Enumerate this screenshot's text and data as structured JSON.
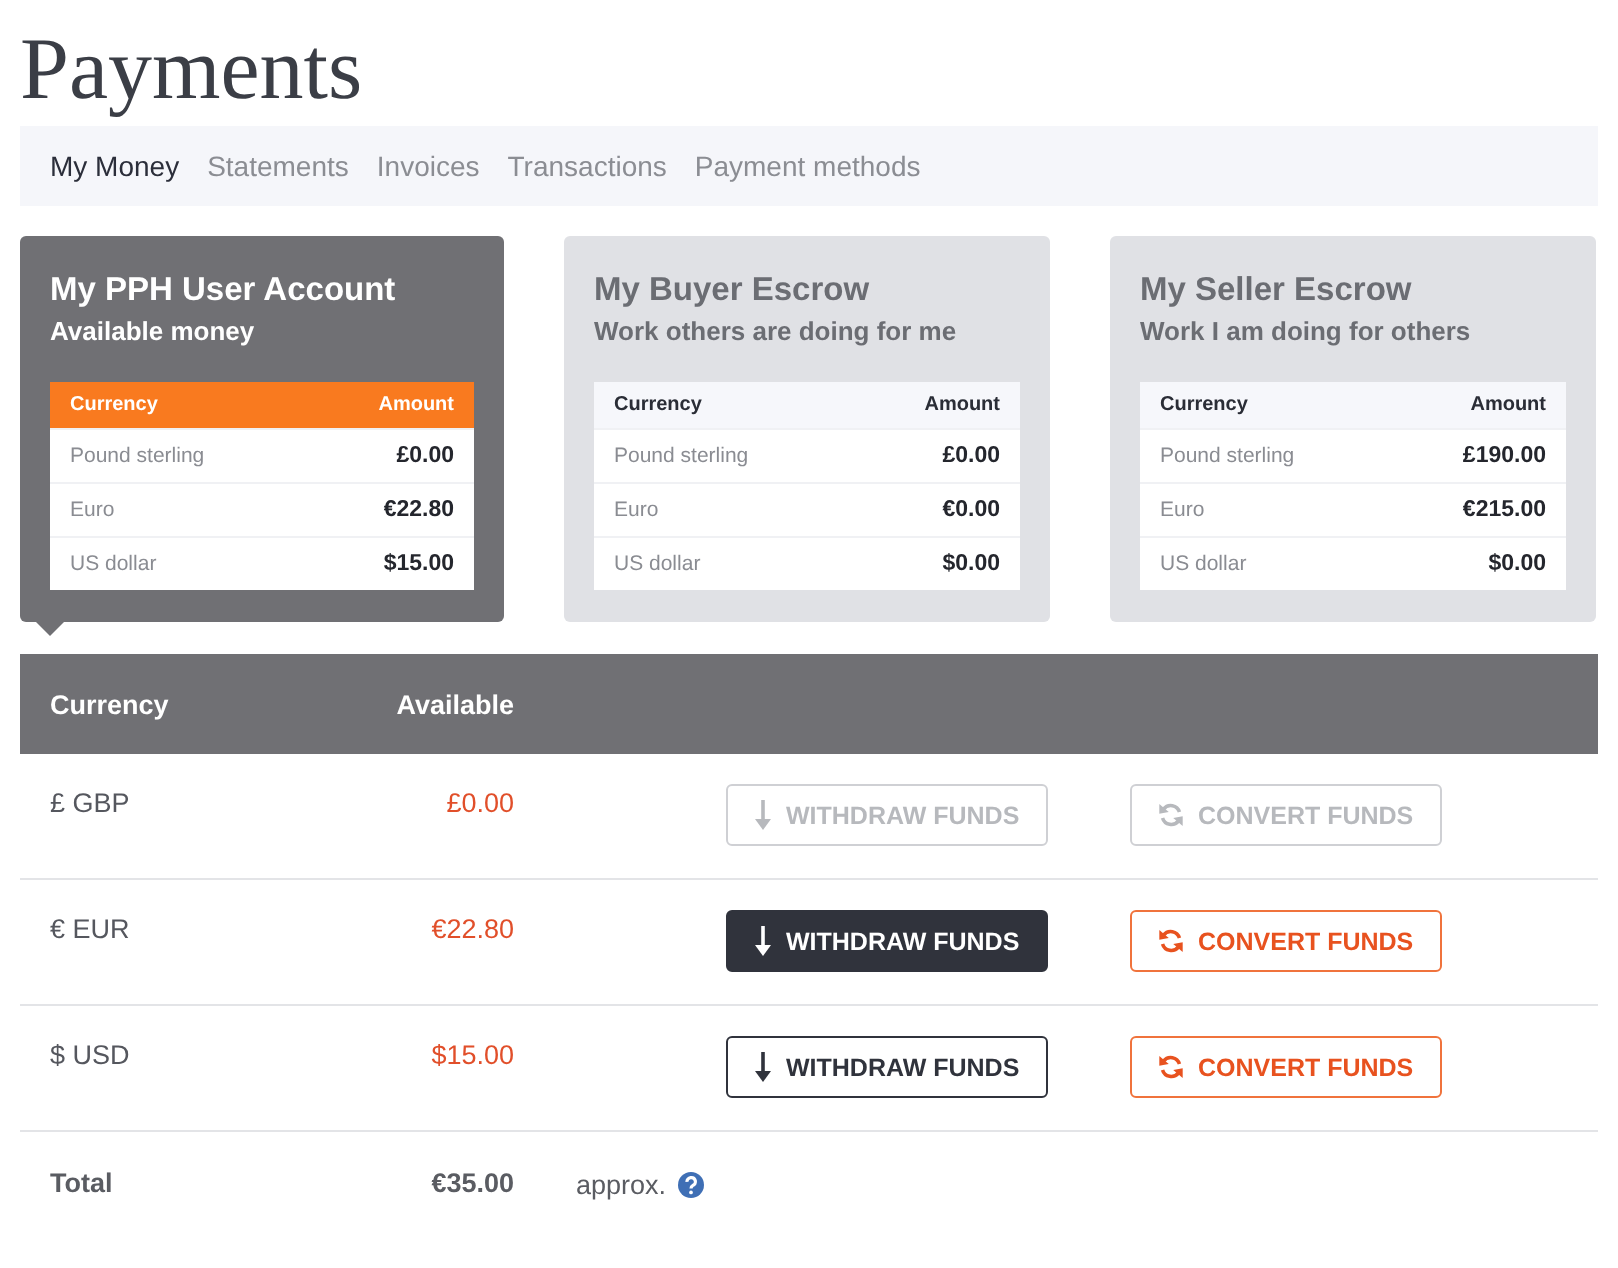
{
  "page": {
    "title": "Payments"
  },
  "tabs": [
    {
      "label": "My Money",
      "selected": true
    },
    {
      "label": "Statements",
      "selected": false
    },
    {
      "label": "Invoices",
      "selected": false
    },
    {
      "label": "Transactions",
      "selected": false
    },
    {
      "label": "Payment methods",
      "selected": false
    }
  ],
  "accounts": [
    {
      "title": "My PPH User Account",
      "subtitle": "Available money",
      "selected": true,
      "columns": [
        "Currency",
        "Amount"
      ],
      "rows": [
        {
          "currency": "Pound sterling",
          "amount": "£0.00"
        },
        {
          "currency": "Euro",
          "amount": "€22.80"
        },
        {
          "currency": "US dollar",
          "amount": "$15.00"
        }
      ]
    },
    {
      "title": "My Buyer Escrow",
      "subtitle": "Work others are doing for me",
      "selected": false,
      "columns": [
        "Currency",
        "Amount"
      ],
      "rows": [
        {
          "currency": "Pound sterling",
          "amount": "£0.00"
        },
        {
          "currency": "Euro",
          "amount": "€0.00"
        },
        {
          "currency": "US dollar",
          "amount": "$0.00"
        }
      ]
    },
    {
      "title": "My Seller Escrow",
      "subtitle": "Work I am doing for others",
      "selected": false,
      "columns": [
        "Currency",
        "Amount"
      ],
      "rows": [
        {
          "currency": "Pound sterling",
          "amount": "£190.00"
        },
        {
          "currency": "Euro",
          "amount": "€215.00"
        },
        {
          "currency": "US dollar",
          "amount": "$0.00"
        }
      ]
    }
  ],
  "balances": {
    "columns": [
      "Currency",
      "Available"
    ],
    "rows": [
      {
        "currency": "£ GBP",
        "available": "£0.00",
        "withdraw": {
          "label": "WITHDRAW FUNDS",
          "kind": "outline",
          "disabled": true
        },
        "convert": {
          "label": "CONVERT FUNDS",
          "disabled": true
        }
      },
      {
        "currency": "€ EUR",
        "available": "€22.80",
        "withdraw": {
          "label": "WITHDRAW FUNDS",
          "kind": "filled",
          "disabled": false
        },
        "convert": {
          "label": "CONVERT FUNDS",
          "disabled": false
        }
      },
      {
        "currency": "$ USD",
        "available": "$15.00",
        "withdraw": {
          "label": "WITHDRAW FUNDS",
          "kind": "outline",
          "disabled": false
        },
        "convert": {
          "label": "CONVERT FUNDS",
          "disabled": false
        }
      }
    ],
    "total": {
      "label": "Total",
      "amount": "€35.00",
      "note": "approx."
    }
  }
}
